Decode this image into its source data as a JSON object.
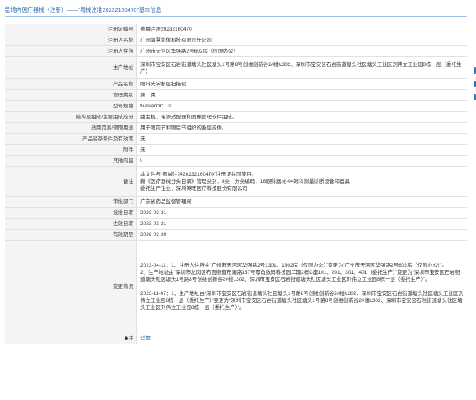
{
  "header": {
    "title": "急境内医疗器械（注册）——“粤械注准20232160470”基本信息"
  },
  "rows": [
    {
      "label": "注册证编号",
      "value": "粤械注准20232160470"
    },
    {
      "label": "注册人名称",
      "value": "广州蒲慧影像科技有限责任公司"
    },
    {
      "label": "注册人住所",
      "value": "广州市天河区华强路2号602房（仅限办公）"
    },
    {
      "label": "生产地址",
      "value": "深圳市宝安区石岩街道塘头社区塘头1号路8号创维创新谷2#楼L302、深圳市宝安区石岩街道塘头社区塘头工业区刘伟立工业园8栋一层（委托生产）"
    },
    {
      "label": "产品名称",
      "value": "眼科光学断层扫描仪"
    },
    {
      "label": "管理类别",
      "value": "第二类"
    },
    {
      "label": "型号规格",
      "value": "MasterOCT II"
    },
    {
      "label": "结构及组成/主要组成成分",
      "value": "由主机、电源适配器和图像管理软件组成。"
    },
    {
      "label": "适用范围/预期用途",
      "value": "用于眼前节和眼后节组织的断层成像。"
    },
    {
      "label": "产品储存条件及有效期",
      "value": "无"
    },
    {
      "label": "附件",
      "value": "无"
    },
    {
      "label": "其他内容",
      "value": "\\"
    },
    {
      "label": "备注",
      "value": "本文件与“粤械注准20232160470”注册证共同使用。\n新《医疗器械分类目录》管理类别：Ⅱ类；分类编码：16眼科器械-04眼科测量诊断设备和器具\n委托生产企业：深圳英旺医疗科技股份有限公司"
    },
    {
      "label": "审批部门",
      "value": "广东省药品监督管理局"
    },
    {
      "label": "批准日期",
      "value": "2023-03-21"
    },
    {
      "label": "生效日期",
      "value": "2023-03-21"
    },
    {
      "label": "有效期至",
      "value": "2028-03-20"
    },
    {
      "label": "变更情况",
      "value": "2023-04-11：1、注册人住所由“广州市天河区华强路2号1301、1302房（仅限办公）”变更为“广州市天河区华强路2号602房（仅限办公）”。\n2、生产地址由“深圳市龙岗区布吉街道布澜路137号零角数码科技园二期2栋C座101、201、301、401（委托生产）”变更为“深圳市宝安区石岩街道塘头社区塘头1号路8号创维创新谷2#楼L302、深圳市宝安区石岩街道塘头社区塘头工业区刘伟立工业园8栋一层（委托生产）”。\n\n2023-11-07：1、生产地址由“深圳市宝安区石岩街道塘头社区塘头1号路8号创维创新谷2#楼L302、深圳市宝安区石岩街道塘头社区塘头工业区刘伟立工业园8栋一层（委托生产）”变更为“深圳市宝安区石岩街道塘头社区塘头1号路8号创维创新谷2#楼L302、深圳市宝安区石岩街道塘头社区塘头工业区刘伟立工业园8栋一层（委托生产）”。"
    },
    {
      "label": "◆注",
      "value": "详情"
    }
  ]
}
